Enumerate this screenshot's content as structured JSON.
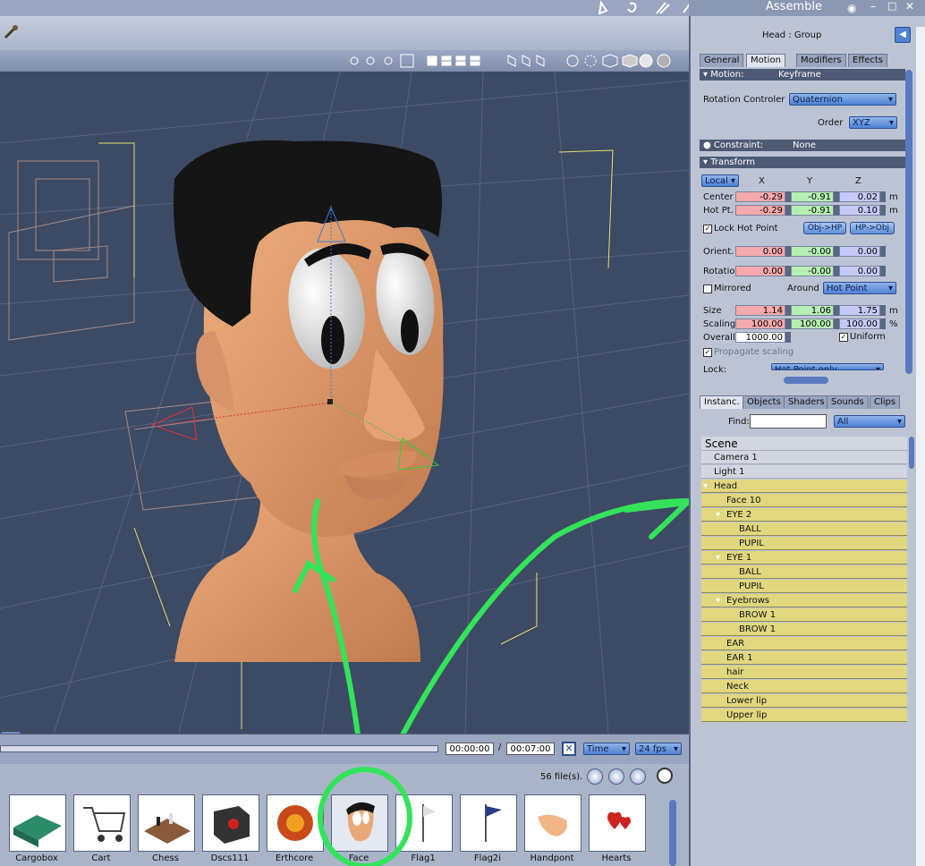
{
  "window": {
    "title": "Assemble"
  },
  "panel": {
    "selection_title": "Head : Group",
    "tabs": [
      "General",
      "Motion",
      "Modifiers",
      "Effects"
    ],
    "active_tab": "Motion",
    "motion": {
      "label": "Motion:",
      "value": "Keyframe"
    },
    "rotation_controller": {
      "label": "Rotation Controler",
      "value": "Quaternion"
    },
    "order": {
      "label": "Order",
      "value": "XYZ"
    },
    "constraint": {
      "label": "Constraint:",
      "value": "None"
    },
    "transform": {
      "title": "Transform",
      "space": "Local",
      "col_x": "X",
      "col_y": "Y",
      "col_z": "Z",
      "center": {
        "label": "Center",
        "x": "-0.29",
        "y": "-0.91",
        "z": "0.02",
        "unit": "m"
      },
      "hot_pt": {
        "label": "Hot Pt.",
        "x": "-0.29",
        "y": "-0.91",
        "z": "0.10",
        "unit": "m"
      },
      "lock_hot_point": "Lock Hot Point",
      "obj_hp": "Obj->HP",
      "hp_obj": "HP->Obj",
      "orient": {
        "label": "Orient.",
        "x": "0.00",
        "y": "-0.00",
        "z": "0.00"
      },
      "rotation": {
        "label": "Rotation",
        "x": "0.00",
        "y": "-0.00",
        "z": "0.00"
      },
      "mirrored": "Mirrored",
      "around": {
        "label": "Around",
        "value": "Hot Point"
      },
      "size": {
        "label": "Size",
        "x": "1.14",
        "y": "1.06",
        "z": "1.75",
        "unit": "m"
      },
      "scaling": {
        "label": "Scaling",
        "x": "100.00",
        "y": "100.00",
        "z": "100.00",
        "unit": "%"
      },
      "overall": {
        "label": "Overall",
        "value": "1000.00"
      },
      "uniform": "Uniform",
      "propagate": "Propagate scaling",
      "lock": {
        "label": "Lock:",
        "value": "Hot Point only"
      }
    }
  },
  "instances": {
    "tabs": [
      "Instanc.",
      "Objects",
      "Shaders",
      "Sounds",
      "Clips"
    ],
    "active_tab": "Instanc.",
    "find_label": "Find:",
    "find_value": "",
    "filter": "All",
    "scene_title": "Scene",
    "rows": [
      {
        "label": "Camera 1",
        "indent": 0,
        "group": false
      },
      {
        "label": "Light 1",
        "indent": 0,
        "group": false
      },
      {
        "label": "Head",
        "indent": 0,
        "group": true
      },
      {
        "label": "Face 10",
        "indent": 1,
        "group": true
      },
      {
        "label": "EYE 2",
        "indent": 1,
        "group": true
      },
      {
        "label": "BALL",
        "indent": 2,
        "group": true
      },
      {
        "label": "PUPIL",
        "indent": 2,
        "group": true
      },
      {
        "label": "EYE 1",
        "indent": 1,
        "group": true
      },
      {
        "label": "BALL",
        "indent": 2,
        "group": true
      },
      {
        "label": "PUPIL",
        "indent": 2,
        "group": true
      },
      {
        "label": "Eyebrows",
        "indent": 1,
        "group": true
      },
      {
        "label": "BROW 1",
        "indent": 2,
        "group": true
      },
      {
        "label": "BROW 1",
        "indent": 2,
        "group": true
      },
      {
        "label": "EAR",
        "indent": 1,
        "group": true
      },
      {
        "label": "EAR 1",
        "indent": 1,
        "group": true
      },
      {
        "label": "hair",
        "indent": 1,
        "group": true
      },
      {
        "label": "Neck",
        "indent": 1,
        "group": true
      },
      {
        "label": "Lower lip",
        "indent": 1,
        "group": true
      },
      {
        "label": "Upper lip",
        "indent": 1,
        "group": true
      }
    ]
  },
  "timeline": {
    "current": "00:00:00",
    "separator": "/",
    "end": "00:07:00",
    "mode": "Time",
    "fps": "24 fps"
  },
  "browser": {
    "file_count": "56 file(s).",
    "items": [
      "Cargobox",
      "Cart",
      "Chess",
      "Dscs111",
      "Erthcore",
      "Face",
      "Flag1",
      "Flag2i",
      "Handpont",
      "Hearts"
    ],
    "selected": "Face"
  },
  "colors": {
    "accent": "#4f82d4",
    "annotation": "#33e35a",
    "panel": "#bcc4d4"
  }
}
